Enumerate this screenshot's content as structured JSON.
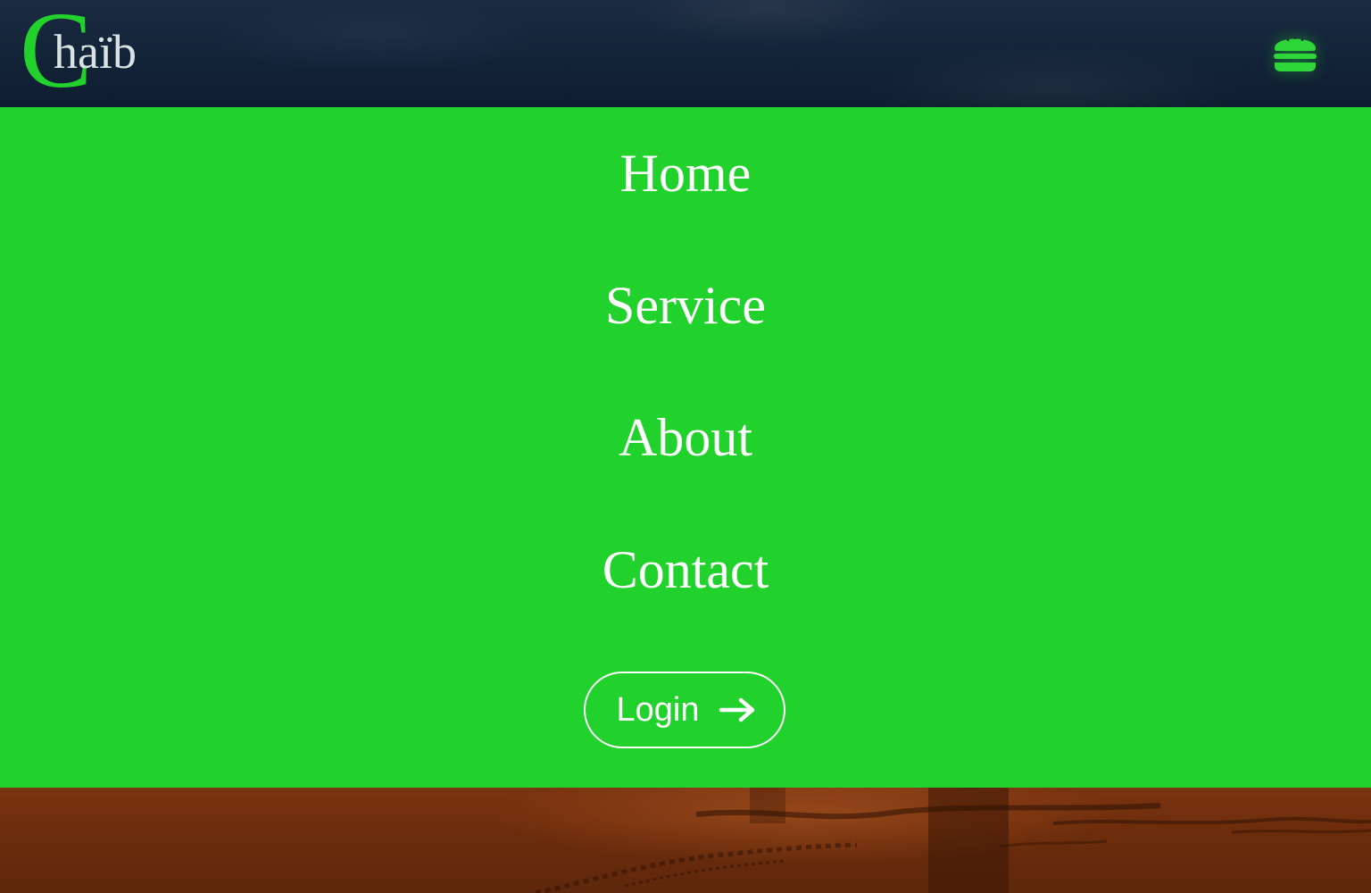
{
  "logo": {
    "initial": "C",
    "rest": "haïb"
  },
  "header": {
    "menu_icon": "hamburger-icon"
  },
  "nav": {
    "items": [
      {
        "label": "Home"
      },
      {
        "label": "Service"
      },
      {
        "label": "About"
      },
      {
        "label": "Contact"
      }
    ],
    "login_label": "Login",
    "login_icon": "arrow-right-icon"
  },
  "colors": {
    "accent": "#22d22c",
    "header_bg": "#132338",
    "text": "#ffffff",
    "logo_rest": "#d9e2e3",
    "sand": "#6d2d0c"
  }
}
